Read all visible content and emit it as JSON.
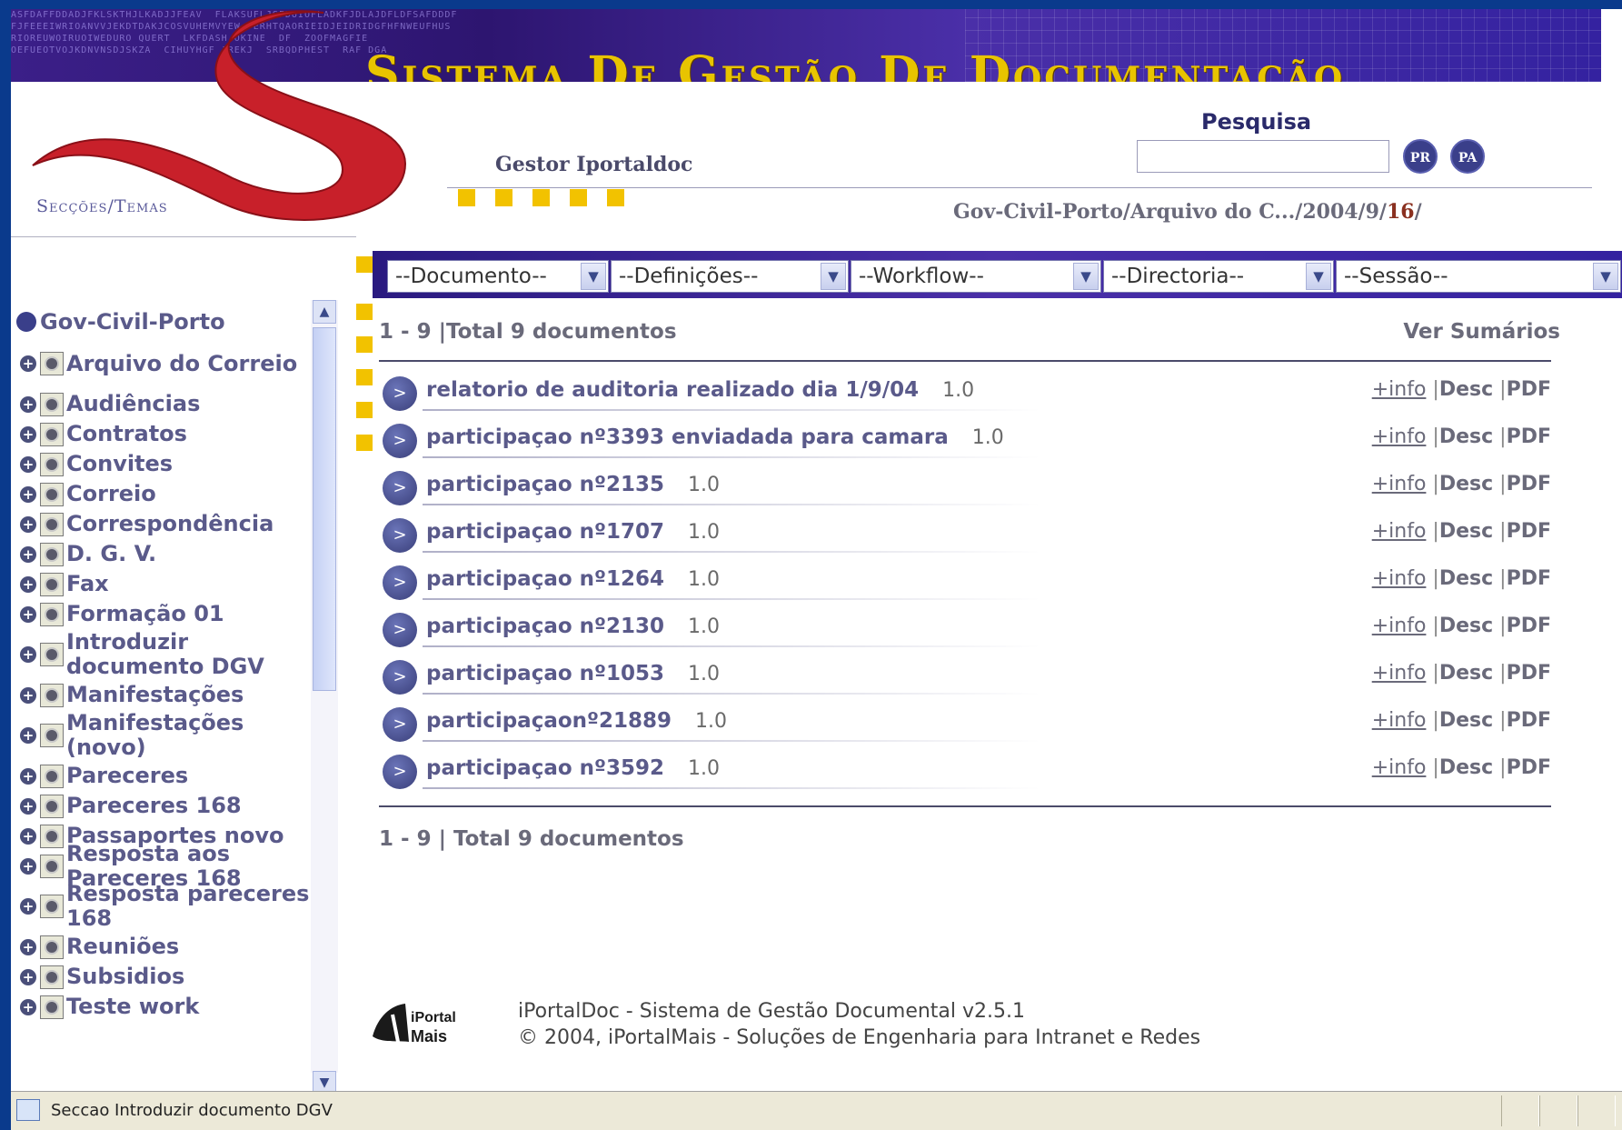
{
  "banner": {
    "noise_text": "ASFDAFFDDADJFKLSKTHJLKADJJFEAV  FLAKSUFLJSFDUIOFLADKFJDLAJDFLDFSAFDDDF\nFJFEEEIWRIOANVVJEKDTDAKJCOSVUHEMVYEW  ERHTQAORIEIDJEIDRIDGFHFNWEUFHUS\nRIOREUWOIRUOIWEDURO QUERT  LKFDASH OKINE  DF  ZOOFMAGFIE\nOEFUEOTVOJKDNVNSDJSKZA  CIHUYHGF JREKJ  SRBQDPHEST  RAF DGA",
    "title": "Sistema De Gestão De Documentação"
  },
  "header": {
    "sections_label": "Secções/Temas",
    "user": "Gestor Iportaldoc",
    "search_label": "Pesquisa",
    "search_value": "",
    "btn_pr": "PR",
    "btn_pa": "PA",
    "breadcrumb_main": "Gov-Civil-Porto/Arquivo do C.../2004/9/",
    "breadcrumb_day": "16",
    "breadcrumb_tail": "/"
  },
  "menus": [
    {
      "label": "--Documento--"
    },
    {
      "label": "--Definições--"
    },
    {
      "label": "--Workflow--"
    },
    {
      "label": "--Directoria--"
    },
    {
      "label": "--Sessão--"
    }
  ],
  "sidebar": {
    "root": "Gov-Civil-Porto",
    "items": [
      {
        "label": "Arquivo do Correio"
      },
      {
        "label": "Audiências"
      },
      {
        "label": "Contratos"
      },
      {
        "label": "Convites"
      },
      {
        "label": "Correio"
      },
      {
        "label": "Correspondência"
      },
      {
        "label": "D. G. V."
      },
      {
        "label": "Fax"
      },
      {
        "label": "Formação 01"
      },
      {
        "label": "Introduzir documento DGV"
      },
      {
        "label": "Manifestações"
      },
      {
        "label": "Manifestações (novo)"
      },
      {
        "label": "Pareceres"
      },
      {
        "label": "Pareceres 168"
      },
      {
        "label": "Passaportes novo"
      },
      {
        "label": "Resposta aos Pareceres 168"
      },
      {
        "label": "Resposta pareceres 168"
      },
      {
        "label": "Reuniões"
      },
      {
        "label": "Subsidios"
      },
      {
        "label": "Teste work"
      }
    ]
  },
  "main": {
    "count_top": "1 - 9 |Total 9 documentos",
    "ver_sumarios": "Ver Sumários",
    "count_bottom": "1 - 9 | Total 9 documentos",
    "action_info": "+info",
    "action_desc": "Desc",
    "action_pdf": "PDF",
    "documents": [
      {
        "title": "relatorio de auditoria realizado dia 1/9/04",
        "version": "1.0"
      },
      {
        "title": "participaçao nº3393 enviadada para camara",
        "version": "1.0"
      },
      {
        "title": "participaçao nº2135",
        "version": "1.0"
      },
      {
        "title": "participaçao nº1707",
        "version": "1.0"
      },
      {
        "title": "participaçao nº1264",
        "version": "1.0"
      },
      {
        "title": "participaçao nº2130",
        "version": "1.0"
      },
      {
        "title": "participaçao nº1053",
        "version": "1.0"
      },
      {
        "title": "participaçaonº21889",
        "version": "1.0"
      },
      {
        "title": "participaçao nº3592",
        "version": "1.0"
      }
    ]
  },
  "footer": {
    "logo_top": "iPortal",
    "logo_bottom": "Mais",
    "line1": "iPortalDoc - Sistema de Gestão Documental v2.5.1",
    "line2": "© 2004, iPortalMais - Soluções de Engenharia para Intranet e Redes"
  },
  "status": {
    "text": "Seccao Introduzir documento DGV"
  },
  "colors": {
    "brand_red": "#c8202a",
    "accent_yellow": "#f2c200",
    "banner_purple": "#3b1f88"
  }
}
